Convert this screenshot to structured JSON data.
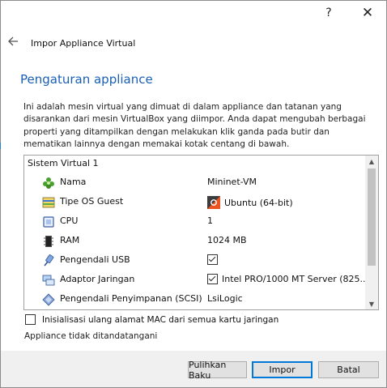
{
  "titlebar": {
    "help_label": "?",
    "close_label": "✕"
  },
  "header": {
    "title": "Impor Appliance Virtual",
    "back_icon": "back-arrow-icon"
  },
  "section": {
    "title": "Pengaturan appliance",
    "description": "Ini adalah mesin virtual yang dimuat di dalam appliance dan tatanan yang disarankan dari mesin VirtualBox yang diimpor. Anda dapat mengubah berbagai properti yang ditampilkan dengan melakukan klik ganda pada butir dan mematikan lainnya dengan memakai kotak centang di bawah."
  },
  "tree": {
    "group_label": "Sistem Virtual 1",
    "rows": [
      {
        "name": "Nama",
        "value": "Mininet-VM",
        "icon": "name-icon"
      },
      {
        "name": "Tipe OS Guest",
        "value": "Ubuntu (64-bit)",
        "icon": "os-type-icon",
        "value_icon": "ubuntu-icon"
      },
      {
        "name": "CPU",
        "value": "1",
        "icon": "cpu-icon"
      },
      {
        "name": "RAM",
        "value": "1024 MB",
        "icon": "ram-icon"
      },
      {
        "name": "Pengendali USB",
        "value": "",
        "icon": "usb-icon",
        "checked": true
      },
      {
        "name": "Adaptor Jaringan",
        "value": "Intel PRO/1000 MT Server (825...",
        "icon": "network-icon",
        "checked": true
      },
      {
        "name": "Pengendali Penyimpanan (SCSI)",
        "value": "LsiLogic",
        "icon": "storage-icon"
      }
    ]
  },
  "mac_option": {
    "label": "Inisialisasi ulang alamat MAC dari semua kartu jaringan",
    "checked": false
  },
  "signature_status": "Appliance tidak ditandatangani",
  "buttons": {
    "reset": "Pulihkan Baku",
    "import": "Impor",
    "cancel": "Batal"
  },
  "colors": {
    "accent": "#1a5fb4",
    "default_button_border": "#0078d7"
  }
}
